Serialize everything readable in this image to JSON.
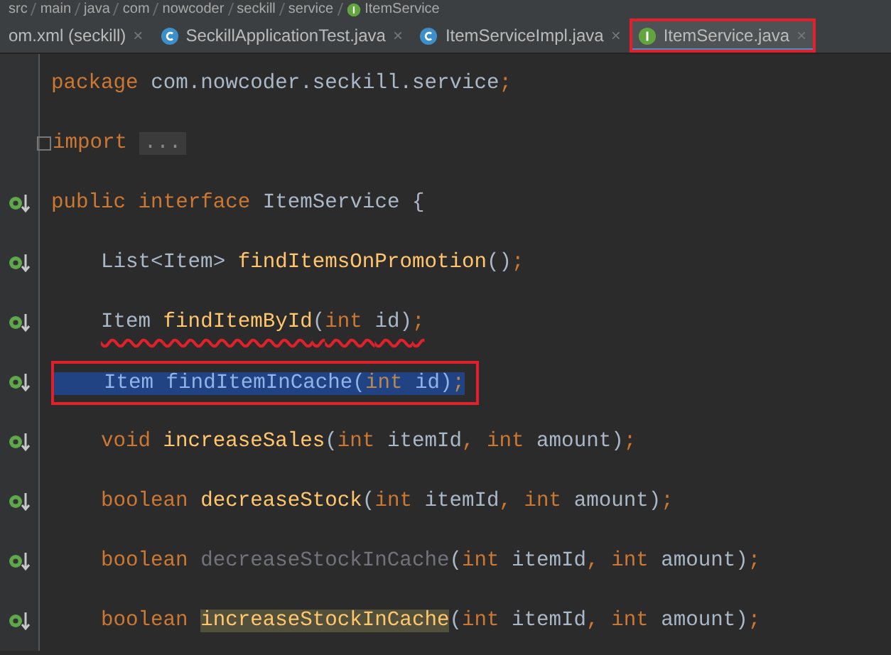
{
  "breadcrumb": [
    {
      "label": "src"
    },
    {
      "label": "main"
    },
    {
      "label": "java"
    },
    {
      "label": "com"
    },
    {
      "label": "nowcoder"
    },
    {
      "label": "seckill"
    },
    {
      "label": "service"
    },
    {
      "label": "ItemService",
      "kind": "interface"
    }
  ],
  "tabs": [
    {
      "label": "om.xml (seckill)",
      "kind": "xml",
      "selected": false,
      "boxed": false,
      "close": "×"
    },
    {
      "label": "SeckillApplicationTest.java",
      "kind": "class",
      "selected": false,
      "boxed": false,
      "close": "×"
    },
    {
      "label": "ItemServiceImpl.java",
      "kind": "class",
      "selected": false,
      "boxed": false,
      "close": "×"
    },
    {
      "label": "ItemService.java",
      "kind": "interface",
      "selected": true,
      "boxed": true,
      "close": "×"
    }
  ],
  "code": [
    {
      "marker": false,
      "fold": false,
      "selected": false,
      "boxed": false,
      "underlined": false,
      "tokens": [
        {
          "kind": "keyword",
          "text": "package "
        },
        {
          "kind": "plain",
          "text": "com.nowcoder.seckill.service"
        },
        {
          "kind": "keyword",
          "text": ";"
        }
      ]
    },
    {
      "marker": false,
      "fold": true,
      "selected": false,
      "boxed": false,
      "underlined": false,
      "tokens": [
        {
          "kind": "keyword",
          "text": "import "
        },
        {
          "kind": "folded",
          "text": "..."
        }
      ]
    },
    {
      "marker": true,
      "fold": false,
      "selected": false,
      "boxed": false,
      "underlined": false,
      "tokens": [
        {
          "kind": "keyword",
          "text": "public interface "
        },
        {
          "kind": "plain",
          "text": "ItemService {"
        }
      ],
      "children": [
        {
          "marker": true,
          "fold": false,
          "selected": false,
          "boxed": false,
          "underlined": false,
          "tokens": [
            {
              "kind": "plain",
              "text": "List<Item> "
            },
            {
              "kind": "method",
              "text": "findItemsOnPromotion"
            },
            {
              "kind": "plain",
              "text": "()"
            },
            {
              "kind": "keyword",
              "text": ";"
            }
          ]
        },
        {
          "marker": true,
          "fold": false,
          "selected": false,
          "boxed": false,
          "underlined": true,
          "tokens": [
            {
              "kind": "plain",
              "text": "Item "
            },
            {
              "kind": "method",
              "text": "findItemById"
            },
            {
              "kind": "plain",
              "text": "("
            },
            {
              "kind": "keyword",
              "text": "int "
            },
            {
              "kind": "plain",
              "text": "id)"
            },
            {
              "kind": "keyword",
              "text": ";"
            }
          ]
        },
        {
          "marker": true,
          "fold": false,
          "selected": true,
          "boxed": true,
          "underlined": false,
          "tokens": [
            {
              "kind": "plain",
              "text": "Item "
            },
            {
              "kind": "method",
              "text": "findItemInCache"
            },
            {
              "kind": "plain",
              "text": "("
            },
            {
              "kind": "keyword",
              "text": "int "
            },
            {
              "kind": "plain",
              "text": "id)"
            },
            {
              "kind": "keyword",
              "text": ";"
            }
          ]
        },
        {
          "marker": true,
          "fold": false,
          "selected": false,
          "boxed": false,
          "underlined": false,
          "tokens": [
            {
              "kind": "keyword",
              "text": "void "
            },
            {
              "kind": "method",
              "text": "increaseSales"
            },
            {
              "kind": "plain",
              "text": "("
            },
            {
              "kind": "keyword",
              "text": "int "
            },
            {
              "kind": "plain",
              "text": "itemId"
            },
            {
              "kind": "keyword",
              "text": ", int "
            },
            {
              "kind": "plain",
              "text": "amount)"
            },
            {
              "kind": "keyword",
              "text": ";"
            }
          ]
        },
        {
          "marker": true,
          "fold": false,
          "selected": false,
          "boxed": false,
          "underlined": false,
          "tokens": [
            {
              "kind": "keyword",
              "text": "boolean "
            },
            {
              "kind": "method",
              "text": "decreaseStock"
            },
            {
              "kind": "plain",
              "text": "("
            },
            {
              "kind": "keyword",
              "text": "int "
            },
            {
              "kind": "plain",
              "text": "itemId"
            },
            {
              "kind": "keyword",
              "text": ", int "
            },
            {
              "kind": "plain",
              "text": "amount)"
            },
            {
              "kind": "keyword",
              "text": ";"
            }
          ]
        },
        {
          "marker": true,
          "fold": false,
          "selected": false,
          "boxed": false,
          "underlined": false,
          "tokens": [
            {
              "kind": "keyword",
              "text": "boolean "
            },
            {
              "kind": "unused",
              "text": "decreaseStockInCache"
            },
            {
              "kind": "plain",
              "text": "("
            },
            {
              "kind": "keyword",
              "text": "int "
            },
            {
              "kind": "plain",
              "text": "itemId"
            },
            {
              "kind": "keyword",
              "text": ", int "
            },
            {
              "kind": "plain",
              "text": "amount)"
            },
            {
              "kind": "keyword",
              "text": ";"
            }
          ]
        },
        {
          "marker": true,
          "fold": false,
          "selected": false,
          "boxed": false,
          "underlined": false,
          "tokens": [
            {
              "kind": "keyword",
              "text": "boolean "
            },
            {
              "kind": "match",
              "text": "increaseStockInCache"
            },
            {
              "kind": "plain",
              "text": "("
            },
            {
              "kind": "keyword",
              "text": "int "
            },
            {
              "kind": "plain",
              "text": "itemId"
            },
            {
              "kind": "keyword",
              "text": ", int "
            },
            {
              "kind": "plain",
              "text": "amount)"
            },
            {
              "kind": "keyword",
              "text": ";"
            }
          ]
        }
      ]
    }
  ]
}
